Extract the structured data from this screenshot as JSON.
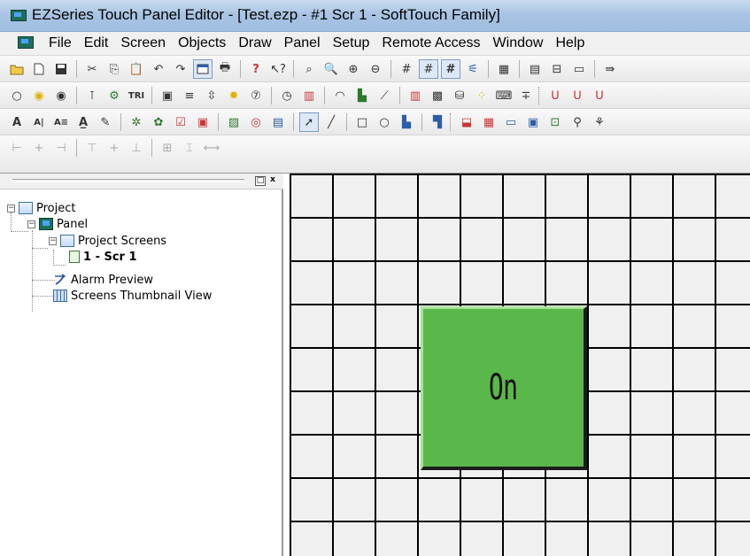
{
  "window": {
    "title": "EZSeries Touch Panel Editor - [Test.ezp - #1 Scr 1 - SoftTouch Family]"
  },
  "menu": {
    "items": [
      "File",
      "Edit",
      "Screen",
      "Objects",
      "Draw",
      "Panel",
      "Setup",
      "Remote Access",
      "Window",
      "Help"
    ]
  },
  "toolbars": {
    "row1_icons": [
      "open-icon",
      "new-icon",
      "save-icon",
      "cut-icon",
      "copy-icon",
      "paste-icon",
      "undo-icon",
      "redo-icon",
      "grid-view-icon",
      "print-icon",
      "help-icon",
      "context-help-icon",
      "find-icon",
      "zoom-fit-icon",
      "zoom-in-icon",
      "zoom-out-icon",
      "grid-icon",
      "grid-snap-icon",
      "grid-dense-icon",
      "alarm-icon",
      "panel-icon",
      "screen-icon",
      "tag-icon",
      "forward-icon"
    ],
    "row2_icons": [
      "circle-icon",
      "indicator-icon",
      "radio-icon",
      "switch-icon",
      "valve-icon",
      "tri-state-icon",
      "numeric-icon",
      "list-icon",
      "selector-icon",
      "light-icon",
      "counter-icon",
      "clock-icon",
      "message-icon",
      "gauge-icon",
      "chart-icon",
      "trend-icon",
      "bargraph-icon",
      "meter-icon",
      "tank-icon",
      "lamps-icon",
      "keypad-icon",
      "level-icon",
      "pilot-light-icon",
      "multi-light-icon",
      "bit-icon",
      "word-icon"
    ],
    "row2_text": {
      "tri_label": "TRI"
    },
    "row3_icons": [
      "text-icon",
      "static-text-icon",
      "dynamic-text-icon",
      "bitmap-text-icon",
      "edit-text-icon",
      "graphic-icon",
      "picture-icon",
      "checkbox-icon",
      "label-icon",
      "bitmap-icon",
      "recipe-icon",
      "color-icon",
      "pointer-icon",
      "line-icon",
      "rectangle-icon",
      "ellipse-icon",
      "fill-icon",
      "frame-icon",
      "message-board-icon",
      "info-icon",
      "image-icon",
      "popup-icon",
      "screen-button-icon",
      "tool-icon",
      "misc-icon"
    ],
    "row4_icons": [
      "align-left-icon",
      "align-center-icon",
      "align-right-icon",
      "align-top-icon",
      "align-middle-icon",
      "align-bottom-icon",
      "center-grid-icon",
      "same-height-icon",
      "same-width-icon"
    ]
  },
  "project_pane": {
    "tree": [
      {
        "label": "Project",
        "level": 0,
        "icon": "project-icon",
        "expanded": true
      },
      {
        "label": "Panel",
        "level": 1,
        "icon": "panel-icon",
        "expanded": true
      },
      {
        "label": "Project Screens",
        "level": 2,
        "icon": "project-icon",
        "expanded": true
      },
      {
        "label": "1 - Scr 1",
        "level": 3,
        "icon": "screen-icon",
        "selected": true
      },
      {
        "label": "Alarm Preview",
        "level": 2,
        "icon": "alarm-icon"
      },
      {
        "label": "Screens Thumbnail View",
        "level": 2,
        "icon": "thumbnail-icon"
      }
    ],
    "buttons": {
      "restore": "□",
      "close": "x"
    }
  },
  "canvas": {
    "object_label": "On",
    "object_color": "#5ab84a"
  }
}
